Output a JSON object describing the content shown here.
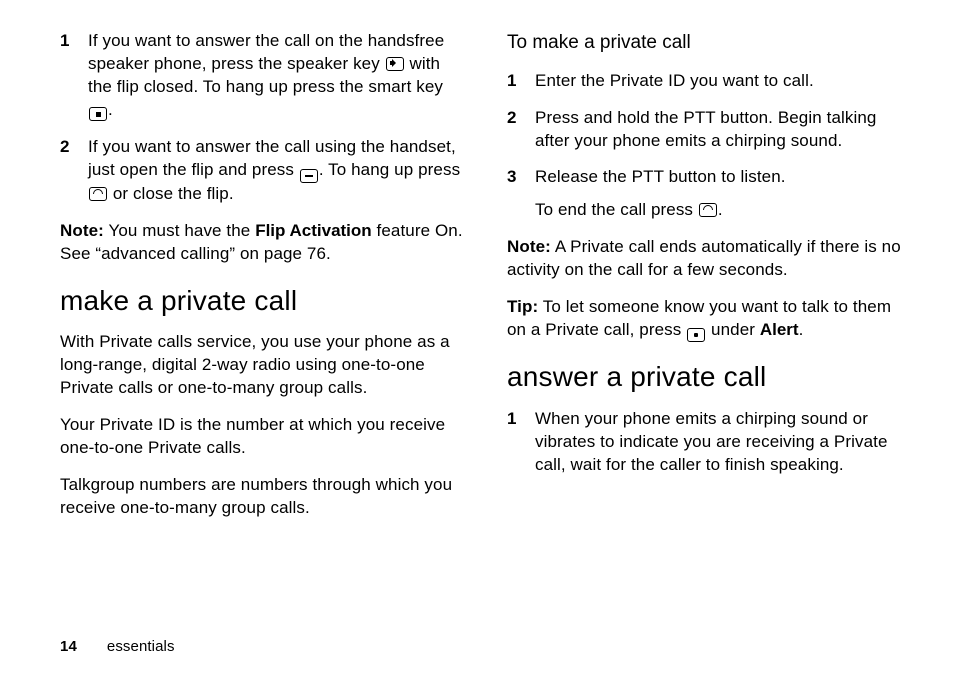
{
  "left": {
    "steps_a": [
      {
        "num": "1",
        "pre": "If you want to answer the call on the handsfree speaker phone, press the speaker key ",
        "mid": " with the flip closed. To hang up press the smart key ",
        "post": "."
      },
      {
        "num": "2",
        "pre": "If you want to answer the call using the handset, just open the flip and press ",
        "mid": ". To hang up press ",
        "post": " or close the flip."
      }
    ],
    "note_label": "Note:",
    "note_pre": " You must have the ",
    "note_feat": "Flip Activation",
    "note_post": " feature On. See “advanced calling” on page 76.",
    "h_make": "make a private call",
    "p1": "With Private calls service, you use your phone as a long-range, digital 2-way radio using one-to-one Private calls or one-to-many group calls.",
    "p2": "Your Private ID is the number at which you receive one-to-one Private calls.",
    "p3": "Talkgroup numbers are numbers through which you receive one-to-many group calls."
  },
  "right": {
    "subhead": "To make a private call",
    "steps_b": [
      {
        "num": "1",
        "txt": "Enter the Private ID you want to call."
      },
      {
        "num": "2",
        "txt": "Press and hold the PTT button. Begin talking after your phone emits a chirping sound."
      },
      {
        "num": "3",
        "txt": "Release the PTT button to listen.",
        "sub_pre": "To end the call press ",
        "sub_post": "."
      }
    ],
    "note_label": "Note:",
    "note_txt": " A Private call ends automatically if there is no activity on the call for a few seconds.",
    "tip_label": "Tip:",
    "tip_pre": " To let someone know you want to talk to them on a Private call, press ",
    "tip_mid": " under ",
    "tip_end": "Alert",
    "tip_post": ".",
    "h_answer": "answer a private call",
    "steps_c": [
      {
        "num": "1",
        "txt": "When your phone emits a chirping sound or vibrates to indicate you are receiving a Private call, wait for the caller to finish speaking."
      }
    ]
  },
  "footer": {
    "page": "14",
    "section": "essentials"
  }
}
